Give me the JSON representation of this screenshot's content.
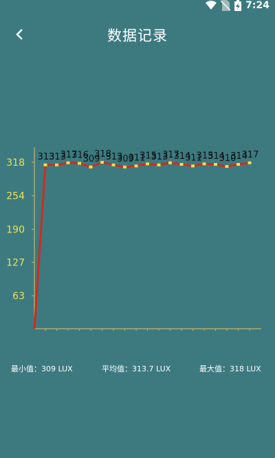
{
  "status_bar": {
    "time": "7:24"
  },
  "header": {
    "title": "数据记录"
  },
  "chart_data": {
    "type": "line",
    "yticks": [
      63,
      127,
      190,
      254,
      318
    ],
    "ylim": [
      0,
      318
    ],
    "values": [
      0,
      313,
      313,
      317,
      316,
      309,
      318,
      313,
      309,
      311,
      315,
      313,
      317,
      314,
      311,
      315,
      314,
      310,
      314,
      317
    ],
    "data_labels": [
      "313",
      "313",
      "317",
      "316",
      "309",
      "318",
      "313",
      "309",
      "311",
      "315",
      "313",
      "317",
      "314",
      "311",
      "315",
      "314",
      "310",
      "314",
      "317"
    ],
    "line_color": "#d42a1e",
    "marker_color": "#f2e14a",
    "axis_color": "#c9b46a",
    "grid": false
  },
  "stats": {
    "min_label": "最小值：309 LUX",
    "avg_label": "平均值：313.7 LUX",
    "max_label": "最大值：318 LUX"
  }
}
